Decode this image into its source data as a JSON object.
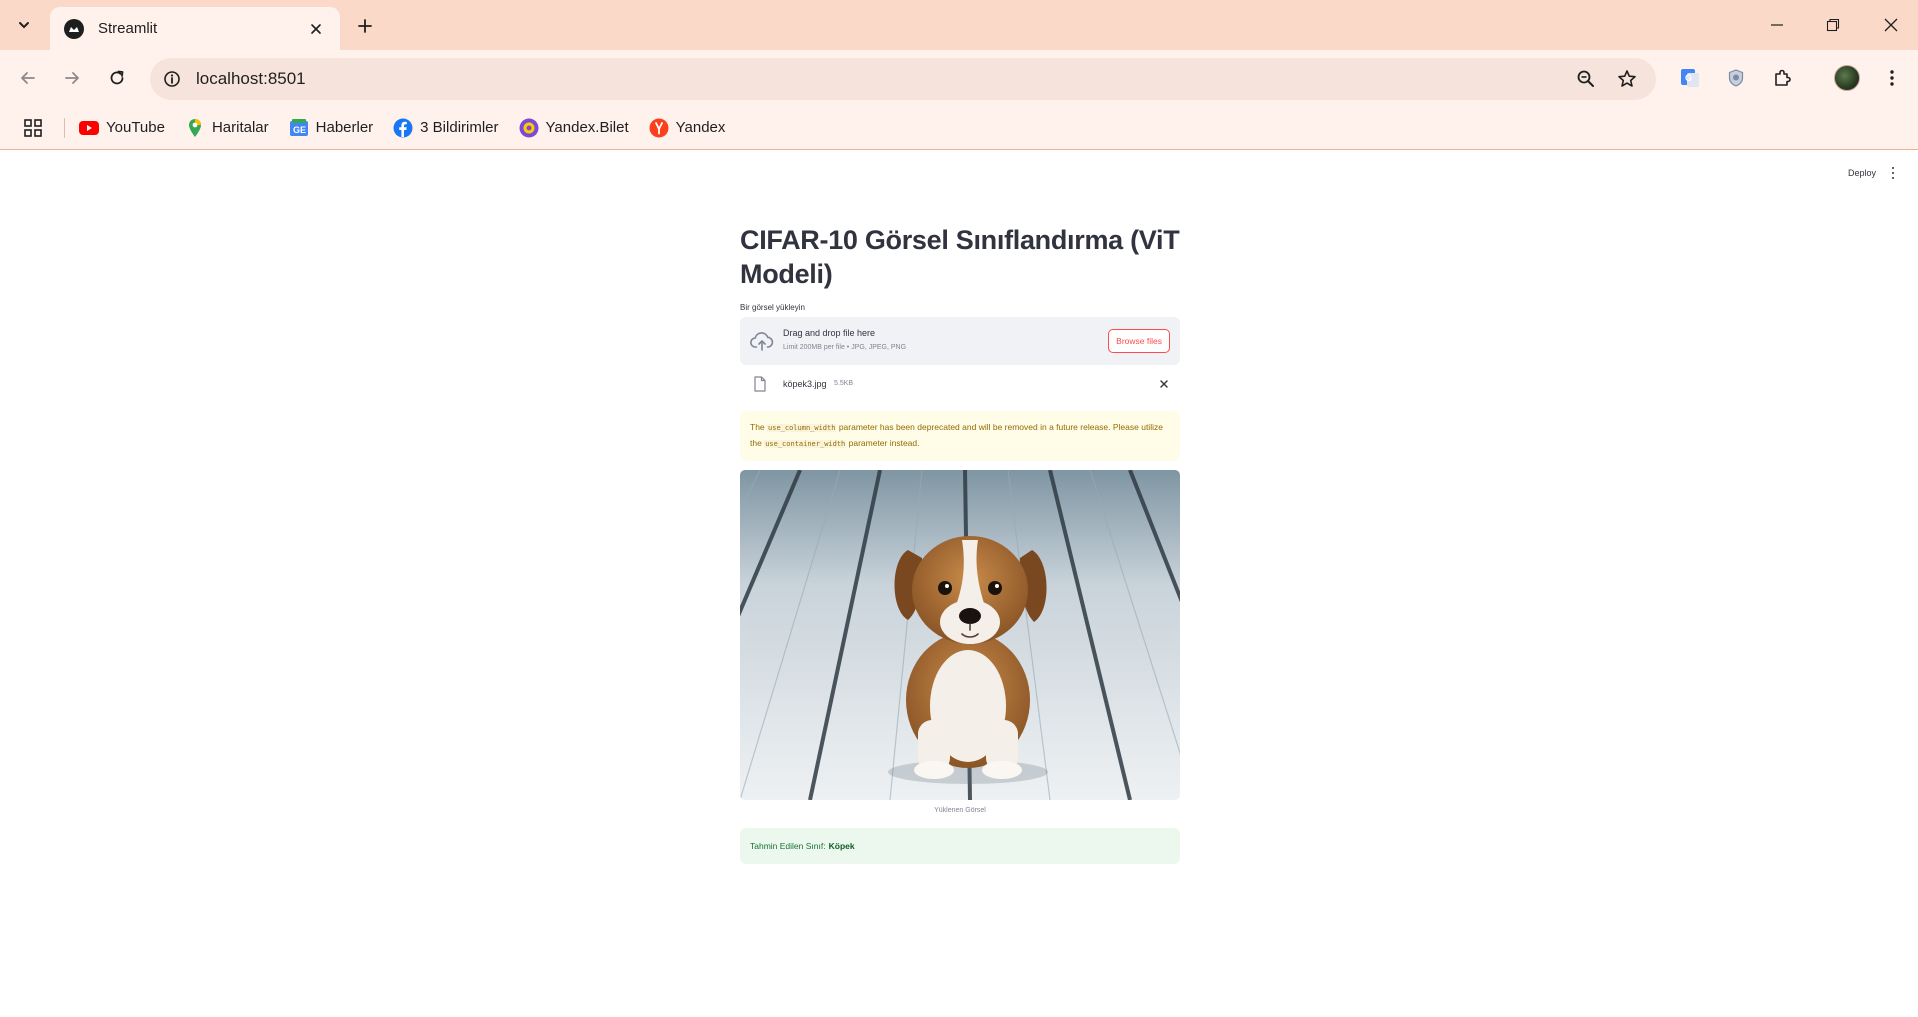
{
  "browser": {
    "tab": {
      "title": "Streamlit"
    },
    "address": {
      "url": "localhost:8501"
    },
    "bookmarks": [
      {
        "label": "YouTube",
        "icon": "youtube-icon",
        "color": "#ff0000"
      },
      {
        "label": "Haritalar",
        "icon": "maps-pin-icon",
        "color": "#34a853"
      },
      {
        "label": "Haberler",
        "icon": "news-icon",
        "color": "#4285f4"
      },
      {
        "label": "3 Bildirimler",
        "icon": "facebook-icon",
        "color": "#1877f2"
      },
      {
        "label": "Yandex.Bilet",
        "icon": "yandex-bilet-icon",
        "color": "#7b4bd8"
      },
      {
        "label": "Yandex",
        "icon": "yandex-icon",
        "color": "#fc3f1d"
      }
    ],
    "colors": {
      "tabstrip": "#fbd9c9",
      "toolbar": "#fff2ec"
    }
  },
  "app": {
    "header": {
      "deploy_label": "Deploy"
    },
    "title": "CIFAR-10 Görsel Sınıflandırma (ViT Modeli)",
    "uploader": {
      "label": "Bir görsel yükleyin",
      "drop_text": "Drag and drop file here",
      "limit_text": "Limit 200MB per file • JPG, JPEG, PNG",
      "browse_label": "Browse files"
    },
    "file": {
      "name": "köpek3.jpg",
      "size": "5.5KB"
    },
    "warning": {
      "part1": "The ",
      "code1": "use_column_width",
      "part2": " parameter has been deprecated and will be removed in a future release. Please utilize the ",
      "code2": "use_container_width",
      "part3": " parameter instead."
    },
    "image": {
      "caption": "Yüklenen Görsel"
    },
    "result": {
      "label": "Tahmin Edilen Sınıf:",
      "value": "Köpek"
    },
    "colors": {
      "primary": "#ff4b4b",
      "text": "#31333f",
      "warning_text": "#926c05",
      "success_text": "#177233"
    }
  }
}
